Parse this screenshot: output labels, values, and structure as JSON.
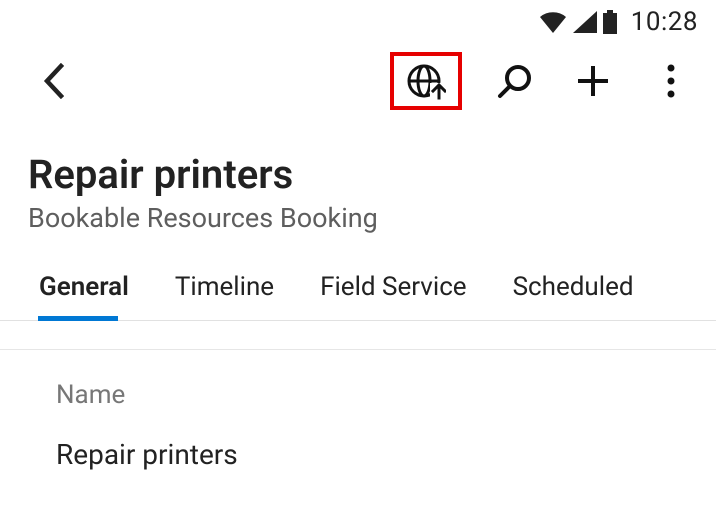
{
  "status_bar": {
    "time": "10:28"
  },
  "action_bar": {
    "icons": {
      "back": "back-icon",
      "globe_up": "globe-upload-icon",
      "search": "search-icon",
      "add": "add-icon",
      "more": "more-vertical-icon"
    }
  },
  "header": {
    "title": "Repair printers",
    "subtitle": "Bookable Resources Booking"
  },
  "tabs": [
    {
      "label": "General",
      "selected": true
    },
    {
      "label": "Timeline",
      "selected": false
    },
    {
      "label": "Field Service",
      "selected": false
    },
    {
      "label": "Scheduled",
      "selected": false
    }
  ],
  "form": {
    "fields": [
      {
        "label": "Name",
        "value": "Repair printers"
      }
    ]
  }
}
